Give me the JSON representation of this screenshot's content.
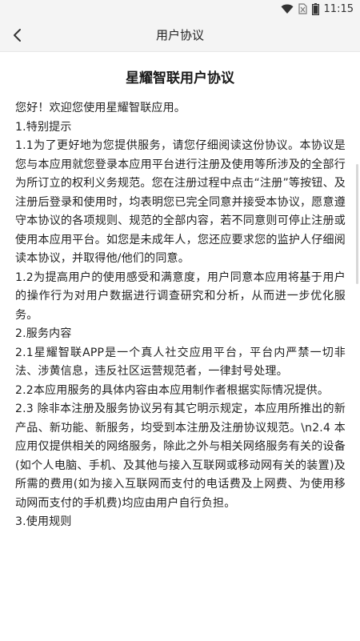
{
  "status_bar": {
    "time": "11:15"
  },
  "nav": {
    "title": "用户协议"
  },
  "document": {
    "title": "星耀智联用户协议",
    "paragraphs": [
      "您好！欢迎您使用星耀智联应用。",
      "1.特别提示",
      "1.1为了更好地为您提供服务，请您仔细阅读这份协议。本协议是您与本应用就您登录本应用平台进行注册及使用等所涉及的全部行为所订立的权利义务规范。您在注册过程中点击“注册”等按钮、及注册后登录和使用时，均表明您已完全同意并接受本协议，愿意遵守本协议的各项规则、规范的全部内容，若不同意则可停止注册或使用本应用平台。如您是未成年人，您还应要求您的监护人仔细阅读本协议，并取得他/他们的同意。",
      "1.2为提高用户的使用感受和满意度，用户同意本应用将基于用户的操作行为对用户数据进行调查研究和分析，从而进一步优化服务。",
      "2.服务内容",
      "2.1星耀智联APP是一个真人社交应用平台，平台内严禁一切非法、涉黄信息，违反社区运营规范者，一律封号处理。",
      "2.2本应用服务的具体内容由本应用制作者根据实际情况提供。",
      "2.3 除非本注册及服务协议另有其它明示规定，本应用所推出的新产品、新功能、新服务，均受到本注册及注册协议规范。\\n2.4 本应用仅提供相关的网络服务，除此之外与相关网络服务有关的设备(如个人电脑、手机、及其他与接入互联网或移动网有关的装置)及所需的费用(如为接入互联网而支付的电话费及上网费、为使用移动网而支付的手机费)均应由用户自行负担。",
      "3.使用规则"
    ]
  }
}
